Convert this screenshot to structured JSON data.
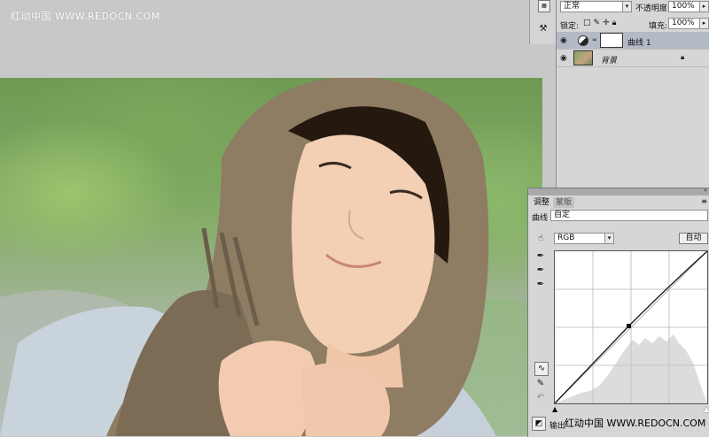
{
  "watermark": {
    "text": "红动中国 WWW.REDOCN.COM"
  },
  "layers_panel": {
    "blend_mode": "正常",
    "opacity_label": "不透明度:",
    "opacity_value": "100%",
    "lock_label": "锁定:",
    "fill_label": "填充:",
    "fill_value": "100%",
    "layers": [
      {
        "name": "曲线 1",
        "selected": true
      },
      {
        "name": "背景",
        "locked": true
      }
    ]
  },
  "adjustments_panel": {
    "tabs": [
      "调整",
      "蒙版"
    ],
    "header_label": "曲线",
    "preset_value": "自定",
    "channel_value": "RGB",
    "auto_button": "自动",
    "output_label": "输出",
    "footer_watermark": "红动中国 WWW.REDOCN.COM"
  },
  "colors": {
    "panel_bg": "#d6d6d6",
    "selected_layer": "#b4b9c6",
    "canvas_bg": "#c8c8c8",
    "histogram": "#dcdcdc"
  }
}
